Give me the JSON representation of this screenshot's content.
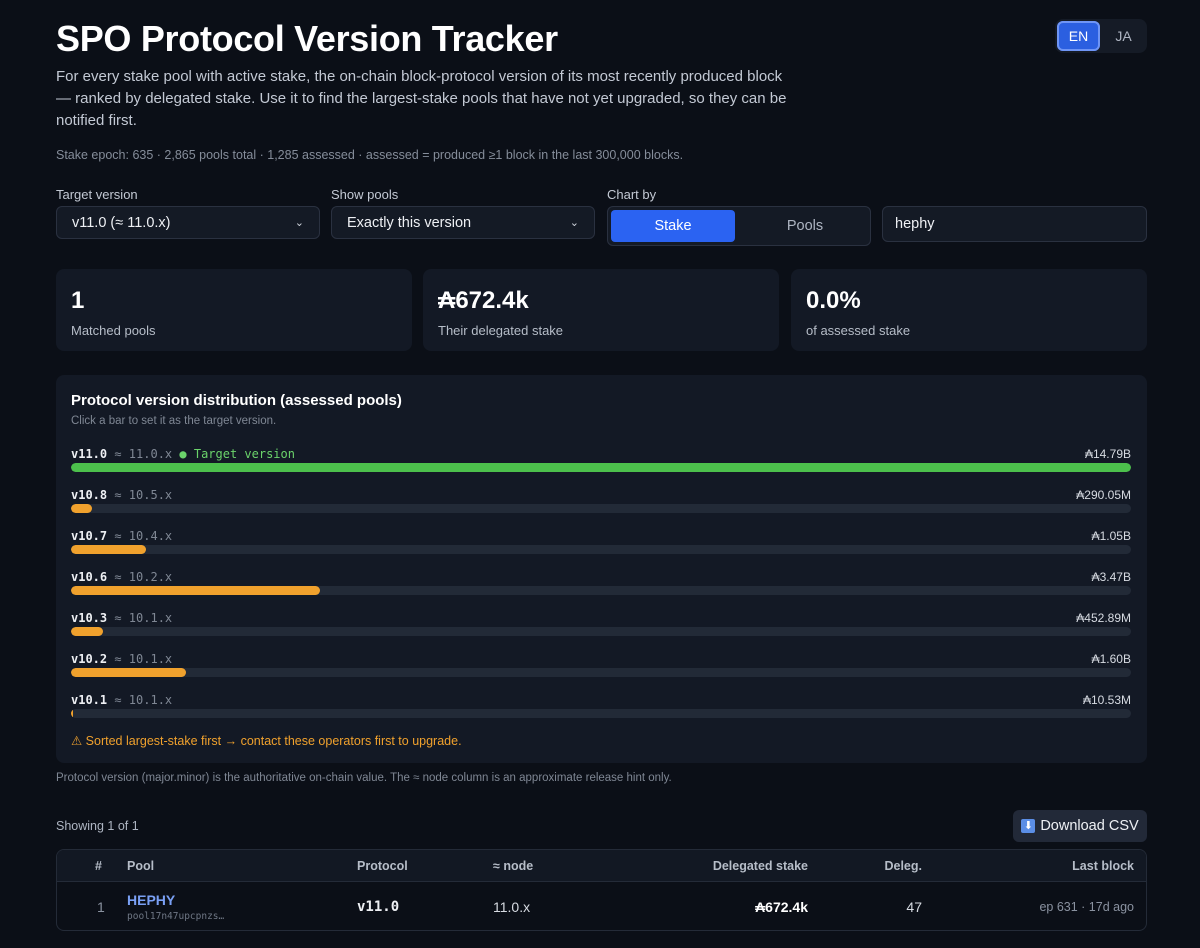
{
  "header": {
    "title": "SPO Protocol Version Tracker",
    "subtitle": "For every stake pool with active stake, the on-chain block-protocol version of its most recently produced block — ranked by delegated stake. Use it to find the largest-stake pools that have not yet upgraded, so they can be notified first.",
    "meta": "Stake epoch: 635 · 2,865 pools total · 1,285 assessed · assessed = produced ≥1 block in the last 300,000 blocks."
  },
  "lang": {
    "en": "EN",
    "ja": "JA",
    "active": "EN"
  },
  "controls": {
    "target_label": "Target version",
    "target_value": "v11.0 (≈ 11.0.x)",
    "show_label": "Show pools",
    "show_value": "Exactly this version",
    "chart_label": "Chart by",
    "chart_stake": "Stake",
    "chart_pools": "Pools",
    "search_value": "hephy"
  },
  "stats": [
    {
      "value": "1",
      "label": "Matched pools"
    },
    {
      "value": "₳672.4k",
      "label": "Their delegated stake"
    },
    {
      "value": "0.0%",
      "label": "of assessed stake"
    }
  ],
  "distribution": {
    "title": "Protocol version distribution (assessed pools)",
    "subtitle": "Click a bar to set it as the target version.",
    "target_tag": "● Target version",
    "max_stake": 14790000000,
    "rows": [
      {
        "version": "v11.0",
        "node": "≈ 11.0.x",
        "stake_label": "₳14.79B",
        "stake": 14790000000,
        "target": true
      },
      {
        "version": "v10.8",
        "node": "≈ 10.5.x",
        "stake_label": "₳290.05M",
        "stake": 290050000,
        "target": false
      },
      {
        "version": "v10.7",
        "node": "≈ 10.4.x",
        "stake_label": "₳1.05B",
        "stake": 1050000000,
        "target": false
      },
      {
        "version": "v10.6",
        "node": "≈ 10.2.x",
        "stake_label": "₳3.47B",
        "stake": 3470000000,
        "target": false
      },
      {
        "version": "v10.3",
        "node": "≈ 10.1.x",
        "stake_label": "₳452.89M",
        "stake": 452890000,
        "target": false
      },
      {
        "version": "v10.2",
        "node": "≈ 10.1.x",
        "stake_label": "₳1.60B",
        "stake": 1600000000,
        "target": false
      },
      {
        "version": "v10.1",
        "node": "≈ 10.1.x",
        "stake_label": "₳10.53M",
        "stake": 10530000,
        "target": false
      }
    ],
    "warning": "⚠ Sorted largest-stake first → contact these operators first to upgrade."
  },
  "footnote": "Protocol version (major.minor) is the authoritative on-chain value. The ≈ node column is an approximate release hint only.",
  "table": {
    "showing": "Showing 1 of 1",
    "download": "Download CSV",
    "download_icon": "⬇",
    "headers": {
      "num": "#",
      "pool": "Pool",
      "protocol": "Protocol",
      "node": "≈ node",
      "stake": "Delegated stake",
      "deleg": "Deleg.",
      "last": "Last block"
    },
    "rows": [
      {
        "num": "1",
        "name": "HEPHY",
        "id": "pool17n47upcpnzs…",
        "protocol": "v11.0",
        "node": "11.0.x",
        "stake": "₳672.4k",
        "deleg": "47",
        "last": "ep 631 · 17d ago"
      }
    ]
  }
}
